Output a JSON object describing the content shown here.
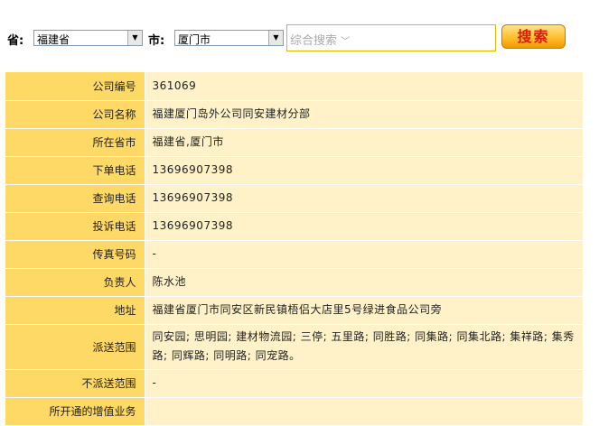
{
  "search": {
    "province_label": "省:",
    "province_value": "福建省",
    "city_label": "市:",
    "city_value": "厦门市",
    "keyword_placeholder": "综合搜索",
    "search_button": "搜索"
  },
  "details": [
    {
      "key": "公司编号",
      "value": "361069"
    },
    {
      "key": "公司名称",
      "value": "福建厦门岛外公司同安建材分部"
    },
    {
      "key": "所在省市",
      "value": "福建省,厦门市"
    },
    {
      "key": "下单电话",
      "value": "13696907398"
    },
    {
      "key": "查询电话",
      "value": "13696907398"
    },
    {
      "key": "投诉电话",
      "value": "13696907398"
    },
    {
      "key": "传真号码",
      "value": "-"
    },
    {
      "key": "负责人",
      "value": "陈水池"
    },
    {
      "key": "地址",
      "value": "福建省厦门市同安区新民镇梧侣大店里5号绿进食品公司旁"
    },
    {
      "key": "派送范围",
      "value": "同安园; 思明园; 建材物流园; 三停; 五里路; 同胜路; 同集路; 同集北路; 集祥路; 集秀路; 同辉路; 同明路; 同宠路。"
    },
    {
      "key": "不派送范围",
      "value": "-"
    },
    {
      "key": "所开通的增值业务",
      "value": ""
    }
  ]
}
